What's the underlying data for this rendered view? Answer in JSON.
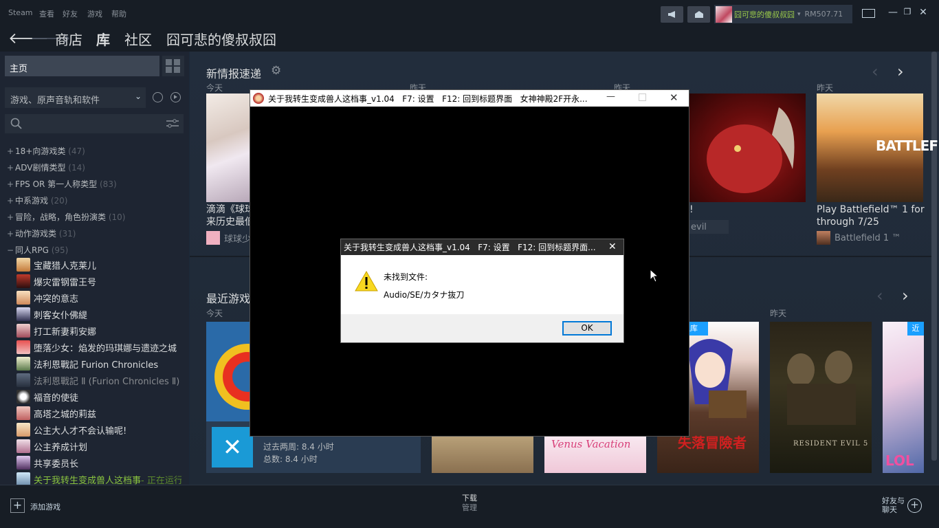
{
  "menubar": {
    "items": [
      "Steam",
      "查看",
      "好友",
      "游戏",
      "帮助"
    ],
    "account_name": "囧可悲的傻叔叔囧",
    "balance": "RM507.71"
  },
  "nav": {
    "links": [
      "商店",
      "库",
      "社区",
      "囧可悲的傻叔叔囧"
    ]
  },
  "left": {
    "home": "主页",
    "filter": "游戏、原声音轨和软件",
    "categories": [
      {
        "name": "18+向游戏类",
        "count": "(47)",
        "expanded": false
      },
      {
        "name": "ADV剧情类型",
        "count": "(14)",
        "expanded": false
      },
      {
        "name": "FPS OR 第一人称类型",
        "count": "(83)",
        "expanded": false
      },
      {
        "name": "中系游戏",
        "count": "(20)",
        "expanded": false
      },
      {
        "name": "冒险，战略，角色扮演类",
        "count": "(10)",
        "expanded": false
      },
      {
        "name": "动作游戏类",
        "count": "(31)",
        "expanded": false
      },
      {
        "name": "同人RPG",
        "count": "(95)",
        "expanded": true
      }
    ],
    "games": [
      {
        "name": "宝藏猎人克莱儿",
        "state": "normal"
      },
      {
        "name": "爆灾雷钢雷王号",
        "state": "normal"
      },
      {
        "name": "冲突的意志",
        "state": "normal"
      },
      {
        "name": "刺客女仆佛緹",
        "state": "normal"
      },
      {
        "name": "打工新妻莉安娜",
        "state": "normal"
      },
      {
        "name": "堕落少女：焰发的玛琪娜与遗迹之城",
        "state": "normal"
      },
      {
        "name": "法利恩戰記 Furion Chronicles",
        "state": "normal"
      },
      {
        "name": "法利恩戰記 Ⅱ (Furion Chronicles Ⅱ)",
        "state": "dim"
      },
      {
        "name": "福音的使徒",
        "state": "normal"
      },
      {
        "name": "高塔之城的莉兹",
        "state": "normal"
      },
      {
        "name": "公主大人才不会认输呢!",
        "state": "normal"
      },
      {
        "name": "公主养成计划",
        "state": "normal"
      },
      {
        "name": "共享委员长",
        "state": "normal"
      },
      {
        "name": "关于我转生变成兽人这档事",
        "state": "running",
        "suffix": " - 正在运行"
      }
    ]
  },
  "news": {
    "title": "新情报速递",
    "days": [
      "今天",
      "昨天",
      "昨天",
      "昨天"
    ],
    "card1_title": "滴滴《球球\n来历史最低",
    "card1_source": "球球少",
    "card3_title": "!",
    "card3_source": "evil",
    "card4_title": "Play Battlefield™ 1 for\nthrough 7/25",
    "card4_source": "Battlefield 1 ™",
    "bf_banner": "BATTLEF"
  },
  "recent": {
    "title": "最近游戏",
    "day_today": "今天",
    "day_yesterday": "昨天",
    "playtime_two_weeks": "过去两周: 8.4 小时",
    "playtime_total": "总数: 8.4 小时",
    "badge_recent": "近期入库",
    "badge_recent2": "近",
    "venus_label": "Venus Vacation",
    "adventurer_label": "失落冒險者",
    "re5_label": "RESIDENT EVIL 5",
    "lol_label": "LOL"
  },
  "bottom": {
    "add_game": "添加游戏",
    "downloads": "下载",
    "manage": "管理",
    "friends": "好友与\n聊天"
  },
  "gamewindow": {
    "title": "关于我转生变成兽人这档事_v1.04   F7: 设置   F12: 回到标题界面   女神神殿2F开永..."
  },
  "dialog": {
    "title": "关于我转生变成兽人这档事_v1.04   F7: 设置   F12: 回到标题界面...",
    "message1": "未找到文件:",
    "message2": "Audio/SE/カタナ抜刀",
    "ok": "OK"
  }
}
